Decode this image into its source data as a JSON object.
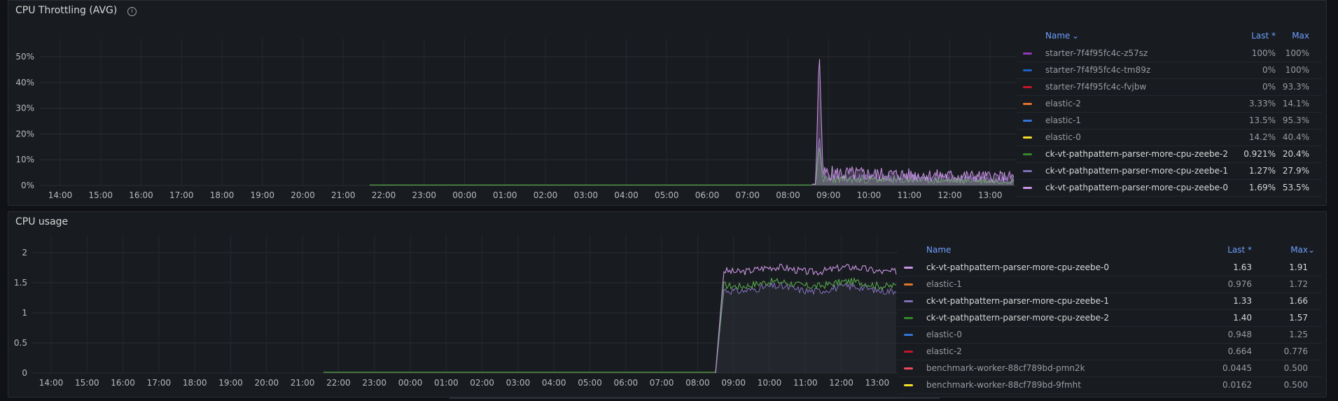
{
  "panels": {
    "throttling": {
      "title": "CPU Throttling (AVG)",
      "y_ticks": [
        "50%",
        "40%",
        "30%",
        "20%",
        "10%",
        "0%"
      ],
      "x_ticks": [
        "14:00",
        "15:00",
        "16:00",
        "17:00",
        "18:00",
        "19:00",
        "20:00",
        "21:00",
        "22:00",
        "23:00",
        "00:00",
        "01:00",
        "02:00",
        "03:00",
        "04:00",
        "05:00",
        "06:00",
        "07:00",
        "08:00",
        "09:00",
        "10:00",
        "11:00",
        "12:00",
        "13:00"
      ],
      "legend": {
        "col_name": "Name",
        "col_last": "Last *",
        "col_max": "Max",
        "rows": [
          {
            "name": "starter-7f4f95fc4c-z57sz",
            "last": "100%",
            "max": "100%",
            "color": "#8f3bb8",
            "dim": true
          },
          {
            "name": "starter-7f4f95fc4c-tm89z",
            "last": "0%",
            "max": "100%",
            "color": "#1f60c4",
            "dim": true
          },
          {
            "name": "starter-7f4f95fc4c-fvjbw",
            "last": "0%",
            "max": "93.3%",
            "color": "#c4162a",
            "dim": true
          },
          {
            "name": "elastic-2",
            "last": "3.33%",
            "max": "14.1%",
            "color": "#e0752d",
            "dim": true
          },
          {
            "name": "elastic-1",
            "last": "13.5%",
            "max": "95.3%",
            "color": "#3274d9",
            "dim": true
          },
          {
            "name": "elastic-0",
            "last": "14.2%",
            "max": "40.4%",
            "color": "#fade2a",
            "dim": true
          },
          {
            "name": "ck-vt-pathpattern-parser-more-cpu-zeebe-2",
            "last": "0.921%",
            "max": "20.4%",
            "color": "#37872d",
            "dim": false
          },
          {
            "name": "ck-vt-pathpattern-parser-more-cpu-zeebe-1",
            "last": "1.27%",
            "max": "27.9%",
            "color": "#806eb7",
            "dim": false
          },
          {
            "name": "ck-vt-pathpattern-parser-more-cpu-zeebe-0",
            "last": "1.69%",
            "max": "53.5%",
            "color": "#ca95e5",
            "dim": false
          }
        ]
      }
    },
    "usage": {
      "title": "CPU usage",
      "y_ticks": [
        "2",
        "1.5",
        "1",
        "0.5",
        "0"
      ],
      "x_ticks": [
        "14:00",
        "15:00",
        "16:00",
        "17:00",
        "18:00",
        "19:00",
        "20:00",
        "21:00",
        "22:00",
        "23:00",
        "00:00",
        "01:00",
        "02:00",
        "03:00",
        "04:00",
        "05:00",
        "06:00",
        "07:00",
        "08:00",
        "09:00",
        "10:00",
        "11:00",
        "12:00",
        "13:00"
      ],
      "legend": {
        "col_name": "Name",
        "col_last": "Last *",
        "col_max": "Max",
        "rows": [
          {
            "name": "ck-vt-pathpattern-parser-more-cpu-zeebe-0",
            "last": "1.63",
            "max": "1.91",
            "color": "#ca95e5",
            "dim": false
          },
          {
            "name": "elastic-1",
            "last": "0.976",
            "max": "1.72",
            "color": "#e0752d",
            "dim": true
          },
          {
            "name": "ck-vt-pathpattern-parser-more-cpu-zeebe-1",
            "last": "1.33",
            "max": "1.66",
            "color": "#806eb7",
            "dim": false
          },
          {
            "name": "ck-vt-pathpattern-parser-more-cpu-zeebe-2",
            "last": "1.40",
            "max": "1.57",
            "color": "#37872d",
            "dim": false
          },
          {
            "name": "elastic-0",
            "last": "0.948",
            "max": "1.25",
            "color": "#3274d9",
            "dim": true
          },
          {
            "name": "elastic-2",
            "last": "0.664",
            "max": "0.776",
            "color": "#c4162a",
            "dim": true
          },
          {
            "name": "benchmark-worker-88cf789bd-pmn2k",
            "last": "0.0445",
            "max": "0.500",
            "color": "#f2495c",
            "dim": true
          },
          {
            "name": "benchmark-worker-88cf789bd-9fmht",
            "last": "0.0162",
            "max": "0.500",
            "color": "#fade2a",
            "dim": true
          }
        ]
      }
    }
  },
  "colors": {
    "accent": "#6e9fff",
    "purple": "#ca95e5",
    "green": "#56a64b",
    "violet": "#806eb7"
  }
}
